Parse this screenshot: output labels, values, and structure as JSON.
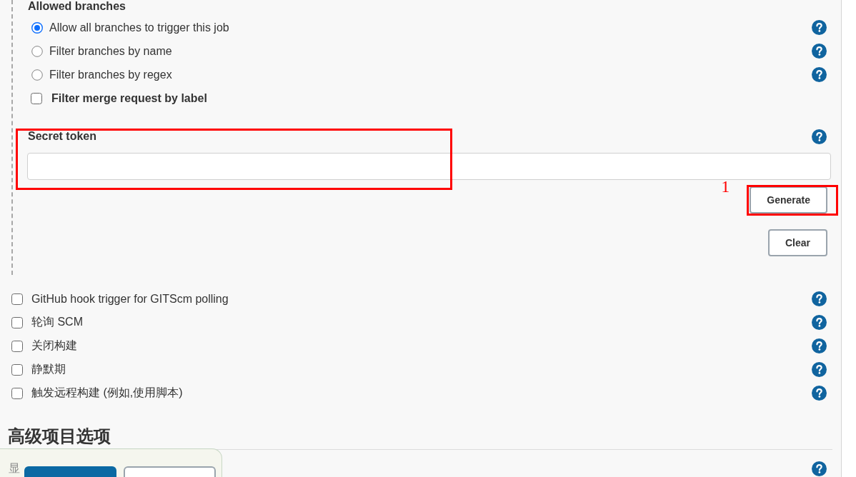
{
  "allowed_branches": {
    "title": "Allowed branches",
    "options": [
      {
        "kind": "radio",
        "label": "Allow all branches to trigger this job",
        "selected": true,
        "help": true
      },
      {
        "kind": "radio",
        "label": "Filter branches by name",
        "selected": false,
        "help": true
      },
      {
        "kind": "radio",
        "label": "Filter branches by regex",
        "selected": false,
        "help": true
      },
      {
        "kind": "checkbox",
        "label": "Filter merge request by label",
        "checked": false,
        "help": false
      }
    ]
  },
  "secret_token": {
    "label": "Secret token",
    "help": true,
    "highlighted": true,
    "buttons": [
      {
        "label": "Generate",
        "highlighted": true,
        "annotation": "1"
      },
      {
        "label": "Clear",
        "highlighted": false
      }
    ]
  },
  "triggers": [
    {
      "label": "GitHub hook trigger for GITScm polling",
      "checked": false,
      "help": true
    },
    {
      "label": "轮询 SCM",
      "checked": false,
      "help": true
    },
    {
      "label": "关闭构建",
      "checked": false,
      "help": true
    },
    {
      "label": "静默期",
      "checked": false,
      "help": true
    },
    {
      "label": "触发远程构建 (例如,使用脚本)",
      "checked": false,
      "help": true
    }
  ],
  "advanced_options": {
    "title": "高级项目选项",
    "fields": [
      {
        "label": "显",
        "help": true
      }
    ]
  },
  "action_bar": {
    "buttons": [
      {
        "kind": "primary"
      },
      {
        "kind": "secondary"
      }
    ]
  }
}
